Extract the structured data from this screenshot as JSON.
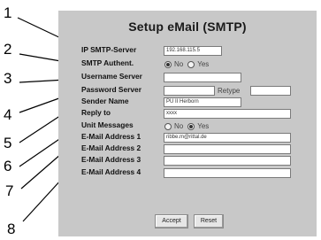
{
  "panel": {
    "title": "Setup eMail (SMTP)"
  },
  "fields": [
    {
      "label": "IP SMTP-Server",
      "value": "192.168.115.5"
    },
    {
      "label": "SMTP Authent.",
      "options": [
        "No",
        "Yes"
      ],
      "selected": "No"
    },
    {
      "label": "Username Server",
      "value": ""
    },
    {
      "label": "Password Server",
      "value": "",
      "retype_label": "Retype",
      "retype_value": ""
    },
    {
      "label": "Sender Name",
      "value": "PU II Herborn"
    },
    {
      "label": "Reply to",
      "value": "xxxx"
    },
    {
      "label": "Unit Messages",
      "options": [
        "No",
        "Yes"
      ],
      "selected": "Yes"
    },
    {
      "label": "E-Mail Address 1",
      "value": "ribbe.m@rittal.de"
    },
    {
      "label": "E-Mail Address 2",
      "value": ""
    },
    {
      "label": "E-Mail Address 3",
      "value": ""
    },
    {
      "label": "E-Mail Address 4",
      "value": ""
    }
  ],
  "buttons": {
    "accept": "Accept",
    "reset": "Reset"
  },
  "callouts": [
    "1",
    "2",
    "3",
    "4",
    "5",
    "6",
    "7",
    "8"
  ],
  "colors": {
    "panel_bg": "#c8c8c8",
    "input_bg": "#ffffff"
  }
}
